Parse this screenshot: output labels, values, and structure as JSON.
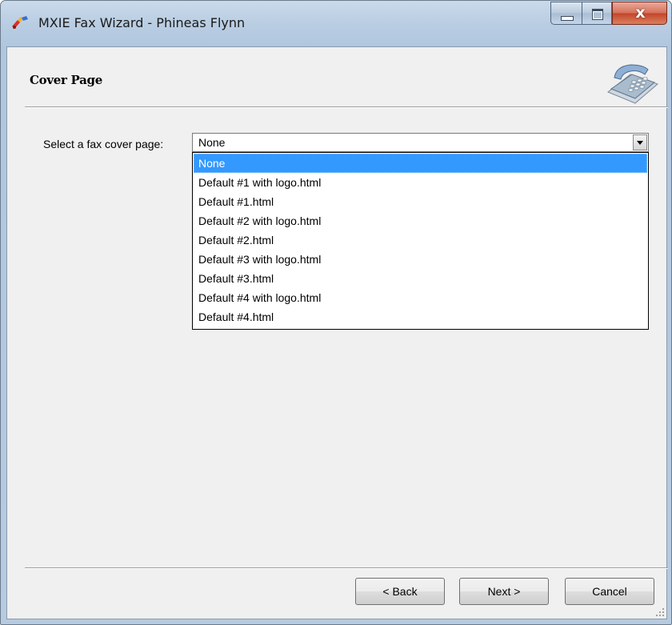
{
  "window": {
    "title": "MXIE Fax Wizard - Phineas Flynn",
    "controls": {
      "close_glyph": "x"
    }
  },
  "page": {
    "title": "Cover Page"
  },
  "cover_page": {
    "label": "Select a fax cover page:",
    "selected_value": "None",
    "options": [
      "None",
      "Default #1 with logo.html",
      "Default #1.html",
      "Default #2 with logo.html",
      "Default #2.html",
      "Default #3 with logo.html",
      "Default #3.html",
      "Default #4 with logo.html",
      "Default #4.html"
    ],
    "highlighted_index": 0
  },
  "buttons": {
    "back": "< Back",
    "next": "Next >",
    "cancel": "Cancel"
  },
  "icons": {
    "app": "fax-wizard-icon",
    "page": "phone-icon"
  },
  "colors": {
    "selection": "#3399ff",
    "close_button": "#c4442a"
  }
}
